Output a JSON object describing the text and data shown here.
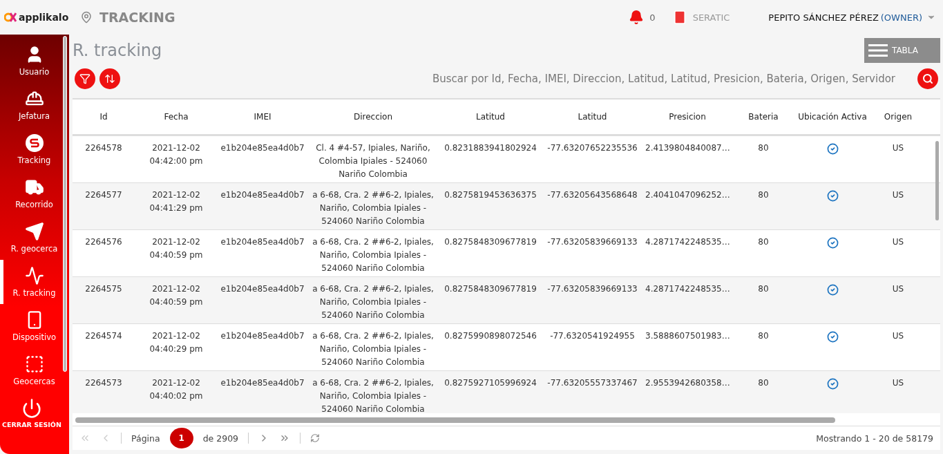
{
  "header": {
    "logo": "applikalo",
    "section": "TRACKING",
    "notifications": "0",
    "company": "SERATIC",
    "user": "PEPITO SÁNCHEZ PÉREZ",
    "role": "(OWNER)"
  },
  "sidebar": {
    "items": [
      {
        "label": "Usuario",
        "kind": "user",
        "selected": false
      },
      {
        "label": "Jefatura",
        "kind": "helmet",
        "selected": false
      },
      {
        "label": "Tracking",
        "kind": "tracking",
        "selected": false
      },
      {
        "label": "Recorrido",
        "kind": "truck",
        "selected": false
      },
      {
        "label": "R. geocerca",
        "kind": "send",
        "selected": false
      },
      {
        "label": "R. tracking",
        "kind": "chart",
        "selected": true
      },
      {
        "label": "Dispositivo",
        "kind": "phone",
        "selected": false
      },
      {
        "label": "Geocercas",
        "kind": "fence",
        "selected": false
      }
    ],
    "logout": "CERRAR SESIÓN"
  },
  "page": {
    "title": "R. tracking",
    "view_button": "TABLA",
    "search": {
      "placeholder": "Buscar por Id, Fecha, IMEI, Direccion, Latitud, Latitud, Presicion, Bateria, Origen, Servidor"
    }
  },
  "table": {
    "columns": [
      "Id",
      "Fecha",
      "IMEI",
      "Direccion",
      "Latitud",
      "Latitud",
      "Presicion",
      "Bateria",
      "Ubicación Activa",
      "Origen"
    ],
    "rows": [
      {
        "id": "2264578",
        "fecha": "2021-12-02 04:42:00 pm",
        "imei": "e1b204e85ea4d0b7",
        "direccion": "Cl. 4 #4-57, Ipiales, Nariño, Colombia Ipiales - 524060 Nariño Colombia",
        "lat1": "0.8231883941802924",
        "lat2": "-77.63207652235536",
        "presicion": "2.4139804840087…",
        "bateria": "80",
        "active": true,
        "origen": "US"
      },
      {
        "id": "2264577",
        "fecha": "2021-12-02 04:41:29 pm",
        "imei": "e1b204e85ea4d0b7",
        "direccion": "a 6-68, Cra. 2 ##6-2, Ipiales, Nariño, Colombia Ipiales - 524060 Nariño Colombia",
        "lat1": "0.8275819453636375",
        "lat2": "-77.63205643568648",
        "presicion": "2.4041047096252…",
        "bateria": "80",
        "active": true,
        "origen": "US"
      },
      {
        "id": "2264576",
        "fecha": "2021-12-02 04:40:59 pm",
        "imei": "e1b204e85ea4d0b7",
        "direccion": "a 6-68, Cra. 2 ##6-2, Ipiales, Nariño, Colombia Ipiales - 524060 Nariño Colombia",
        "lat1": "0.8275848309677819",
        "lat2": "-77.63205839669133",
        "presicion": "4.2871742248535…",
        "bateria": "80",
        "active": true,
        "origen": "US"
      },
      {
        "id": "2264575",
        "fecha": "2021-12-02 04:40:59 pm",
        "imei": "e1b204e85ea4d0b7",
        "direccion": "a 6-68, Cra. 2 ##6-2, Ipiales, Nariño, Colombia Ipiales - 524060 Nariño Colombia",
        "lat1": "0.8275848309677819",
        "lat2": "-77.63205839669133",
        "presicion": "4.2871742248535…",
        "bateria": "80",
        "active": true,
        "origen": "US"
      },
      {
        "id": "2264574",
        "fecha": "2021-12-02 04:40:29 pm",
        "imei": "e1b204e85ea4d0b7",
        "direccion": "a 6-68, Cra. 2 ##6-2, Ipiales, Nariño, Colombia Ipiales - 524060 Nariño Colombia",
        "lat1": "0.8275990898072546",
        "lat2": "-77.6320541924955",
        "presicion": "3.5888607501983…",
        "bateria": "80",
        "active": true,
        "origen": "US"
      },
      {
        "id": "2264573",
        "fecha": "2021-12-02 04:40:02 pm",
        "imei": "e1b204e85ea4d0b7",
        "direccion": "a 6-68, Cra. 2 ##6-2, Ipiales, Nariño, Colombia Ipiales - 524060 Nariño Colombia",
        "lat1": "0.8275927105996924",
        "lat2": "-77.63205557337467",
        "presicion": "2.9553942680358…",
        "bateria": "80",
        "active": true,
        "origen": "US"
      }
    ]
  },
  "pager": {
    "page_label": "Página",
    "page": "1",
    "of": "de 2909",
    "summary": "Mostrando 1 - 20 de 58179"
  }
}
